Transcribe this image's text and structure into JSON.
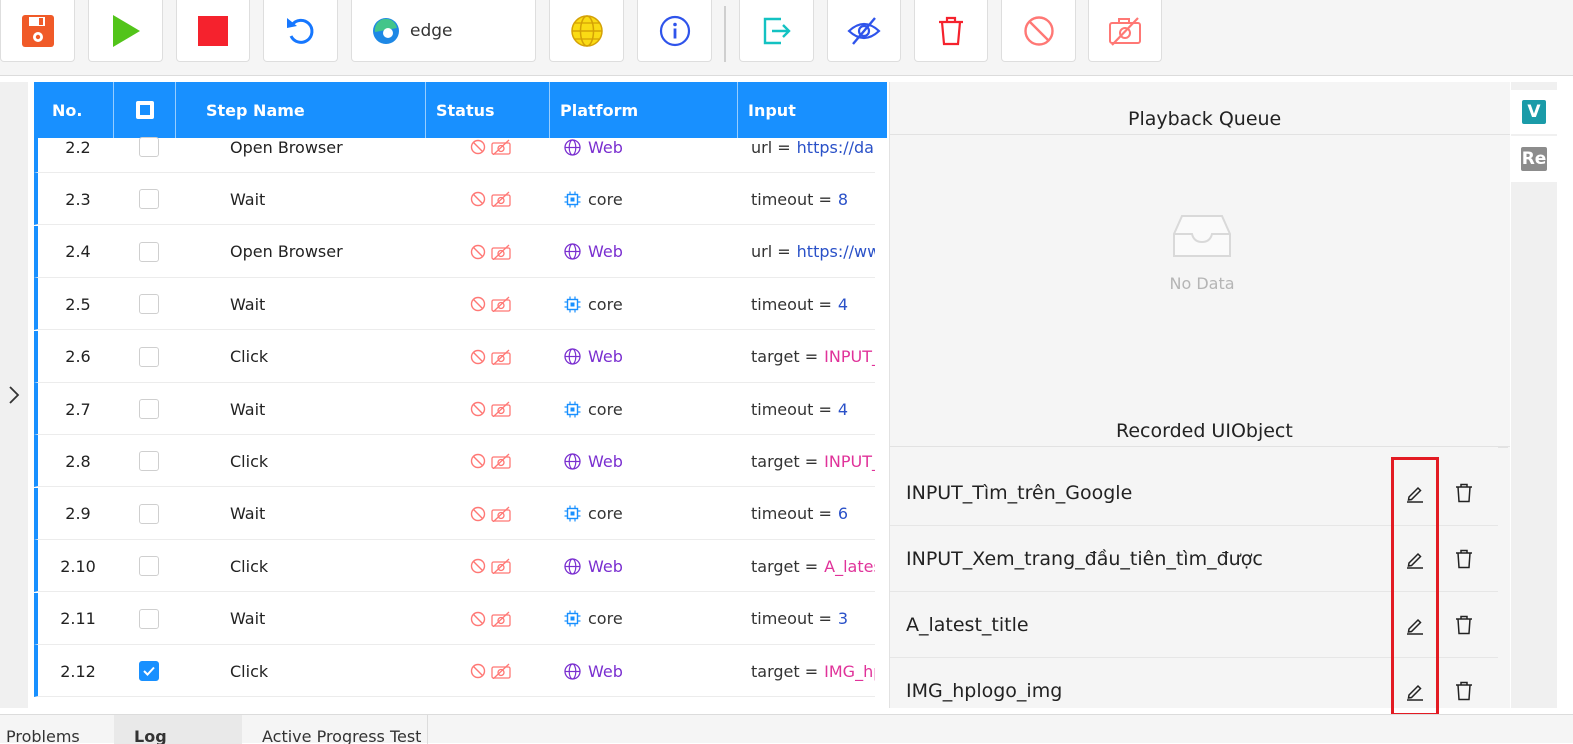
{
  "toolbar": {
    "browser_label": "edge",
    "colors": {
      "save": "#f05a28",
      "run": "#52c41a",
      "stop": "#f5222d",
      "refresh": "#1677ff",
      "info": "#2f54eb",
      "teal": "#13c2c2",
      "danger": "#f5222d"
    }
  },
  "table": {
    "headers": {
      "no": "No.",
      "step_name": "Step Name",
      "status": "Status",
      "platform": "Platform",
      "input": "Input"
    },
    "rows": [
      {
        "no": "2.2",
        "checked": false,
        "step": "Open Browser",
        "platform": "Web",
        "key": "url =",
        "value": "https://dan",
        "vtype": "link"
      },
      {
        "no": "2.3",
        "checked": false,
        "step": "Wait",
        "platform": "core",
        "key": "timeout =",
        "value": "8",
        "vtype": "num"
      },
      {
        "no": "2.4",
        "checked": false,
        "step": "Open Browser",
        "platform": "Web",
        "key": "url =",
        "value": "https://www",
        "vtype": "link"
      },
      {
        "no": "2.5",
        "checked": false,
        "step": "Wait",
        "platform": "core",
        "key": "timeout =",
        "value": "4",
        "vtype": "num"
      },
      {
        "no": "2.6",
        "checked": false,
        "step": "Click",
        "platform": "Web",
        "key": "target =",
        "value": "INPUT_T",
        "vtype": "target"
      },
      {
        "no": "2.7",
        "checked": false,
        "step": "Wait",
        "platform": "core",
        "key": "timeout =",
        "value": "4",
        "vtype": "num"
      },
      {
        "no": "2.8",
        "checked": false,
        "step": "Click",
        "platform": "Web",
        "key": "target =",
        "value": "INPUT_X",
        "vtype": "target"
      },
      {
        "no": "2.9",
        "checked": false,
        "step": "Wait",
        "platform": "core",
        "key": "timeout =",
        "value": "6",
        "vtype": "num"
      },
      {
        "no": "2.10",
        "checked": false,
        "step": "Click",
        "platform": "Web",
        "key": "target =",
        "value": "A_latest_",
        "vtype": "target"
      },
      {
        "no": "2.11",
        "checked": false,
        "step": "Wait",
        "platform": "core",
        "key": "timeout =",
        "value": "3",
        "vtype": "num"
      },
      {
        "no": "2.12",
        "checked": true,
        "step": "Click",
        "platform": "Web",
        "key": "target =",
        "value": "IMG_hpl",
        "vtype": "target"
      }
    ]
  },
  "playback_queue": {
    "title": "Playback Queue",
    "empty_text": "No Data"
  },
  "recorded_uiobject": {
    "title": "Recorded UIObject",
    "items": [
      "INPUT_Tìm_trên_Google",
      "INPUT_Xem_trang_đầu_tiên_tìm_được",
      "A_latest_title",
      "IMG_hplogo_img"
    ]
  },
  "side_tabs": [
    {
      "label": "V",
      "color": "#1a9ba8"
    },
    {
      "label": "Re",
      "color": "#8c8c8c"
    }
  ],
  "bottom_tabs": [
    "Problems",
    "Log",
    "Active Progress Test"
  ]
}
